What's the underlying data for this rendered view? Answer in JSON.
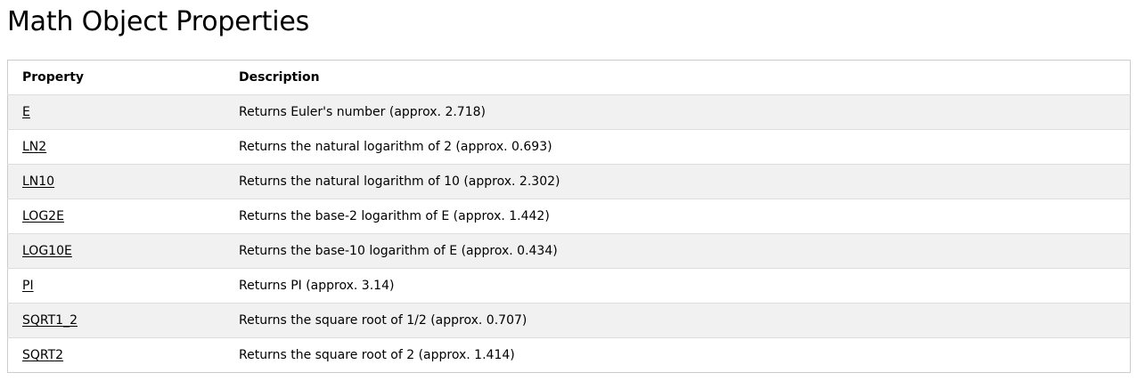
{
  "page": {
    "title": "Math Object Properties"
  },
  "table": {
    "headers": {
      "property": "Property",
      "description": "Description"
    },
    "rows": [
      {
        "property": "E",
        "description": "Returns Euler's number (approx. 2.718)"
      },
      {
        "property": "LN2",
        "description": "Returns the natural logarithm of 2 (approx. 0.693)"
      },
      {
        "property": "LN10",
        "description": "Returns the natural logarithm of 10 (approx. 2.302)"
      },
      {
        "property": "LOG2E",
        "description": "Returns the base-2 logarithm of E (approx. 1.442)"
      },
      {
        "property": "LOG10E",
        "description": "Returns the base-10 logarithm of E (approx. 0.434)"
      },
      {
        "property": "PI",
        "description": "Returns PI (approx. 3.14)"
      },
      {
        "property": "SQRT1_2",
        "description": "Returns the square root of 1/2 (approx. 0.707)"
      },
      {
        "property": "SQRT2",
        "description": "Returns the square root of 2 (approx. 1.414)"
      }
    ]
  },
  "colors": {
    "stripe": "#f1f1f1",
    "border": "#cccccc",
    "row_divider": "#dddddd",
    "text": "#000000"
  }
}
